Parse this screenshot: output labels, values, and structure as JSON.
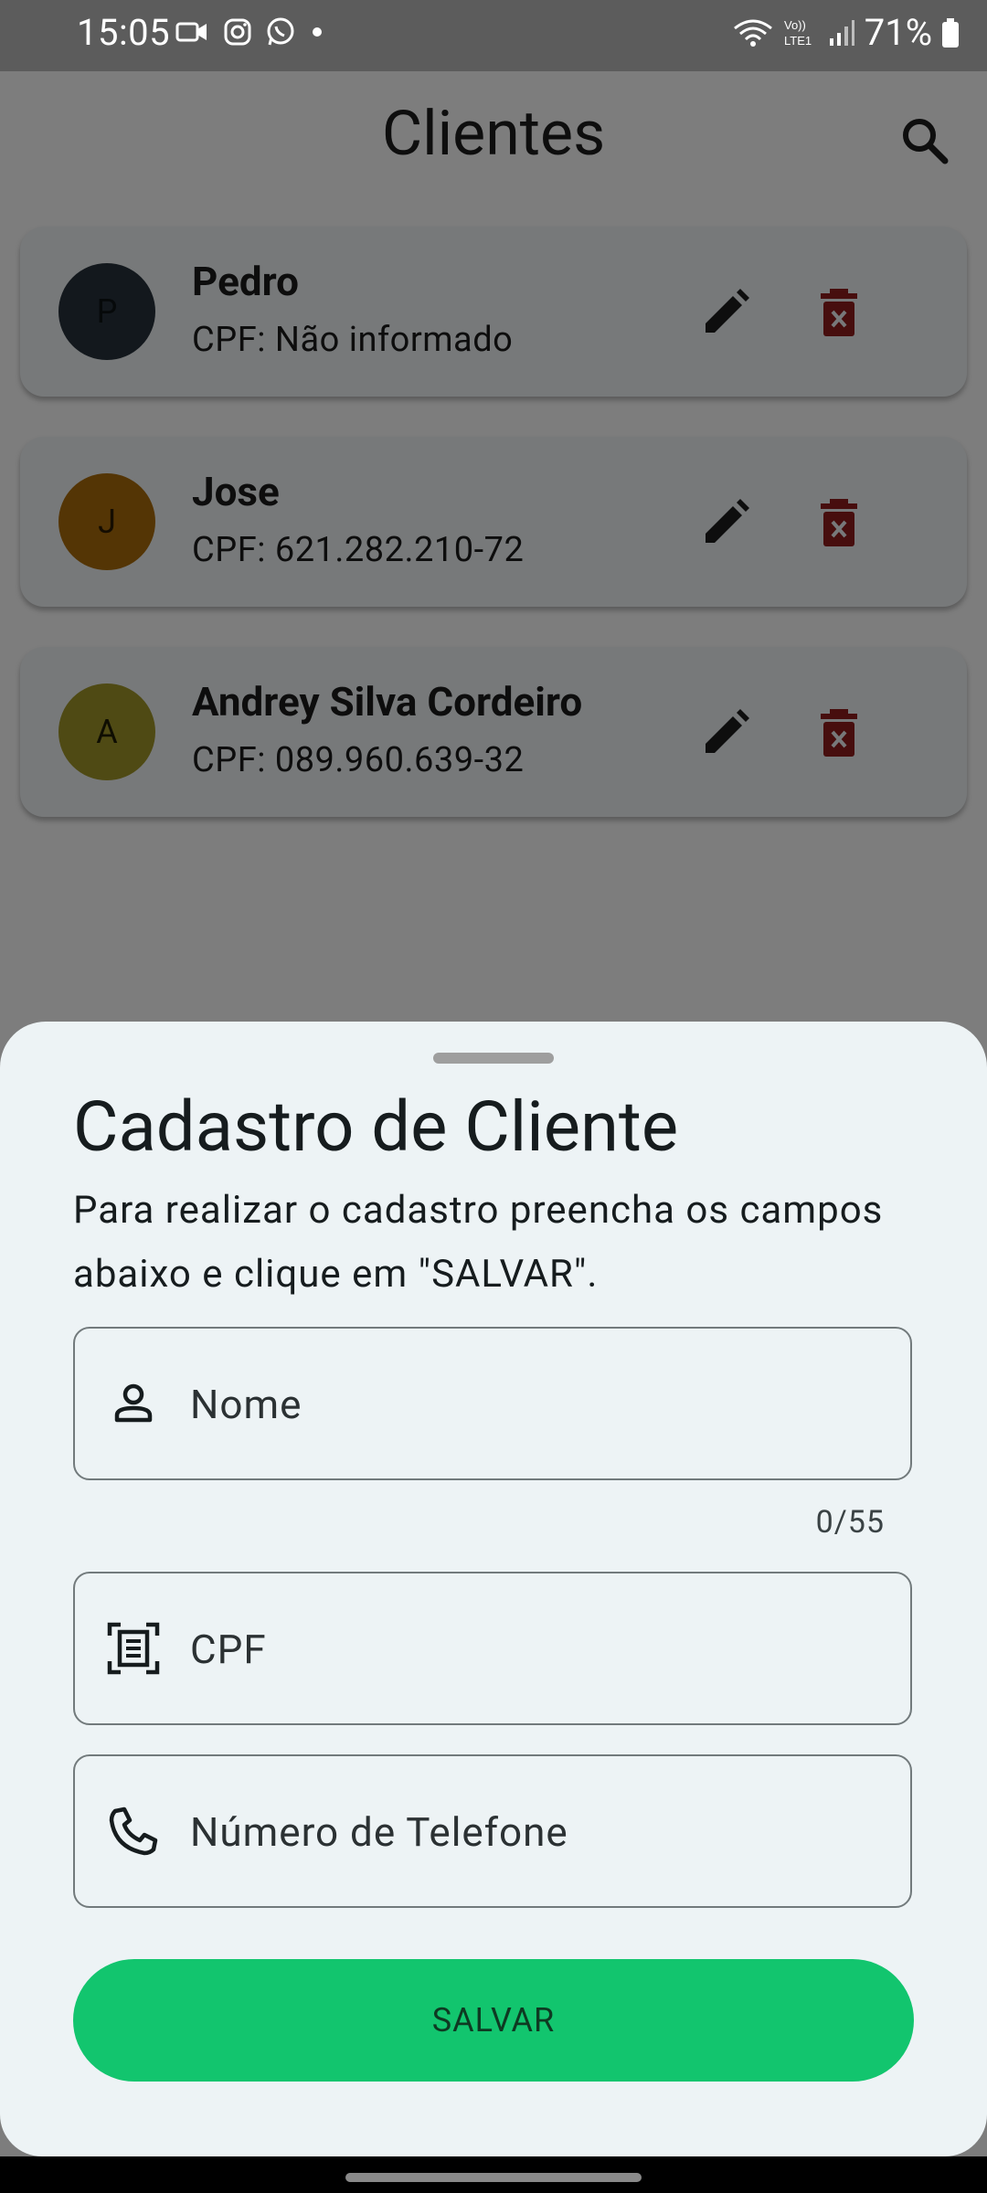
{
  "status_bar": {
    "time": "15:05",
    "left_icons": [
      "video-icon",
      "instagram-icon",
      "whatsapp-icon",
      "dot-icon"
    ],
    "right_icons": [
      "wifi-icon",
      "volte-icon",
      "signal-icon",
      "battery-icon"
    ],
    "battery_percent": "71%"
  },
  "app_bar": {
    "title": "Clientes",
    "search_icon": "search-icon"
  },
  "clients": [
    {
      "initial": "P",
      "name": "Pedro",
      "cpf": "CPF: Não informado",
      "avatar_color": "#26313a"
    },
    {
      "initial": "J",
      "name": "Jose",
      "cpf": "CPF: 621.282.210-72",
      "avatar_color": "#a86a0a"
    },
    {
      "initial": "A",
      "name": "Andrey Silva Cordeiro",
      "cpf": "CPF: 089.960.639-32",
      "avatar_color": "#9e9429"
    }
  ],
  "sheet": {
    "title": "Cadastro de Cliente",
    "description": "Para realizar o cadastro preencha os campos abaixo e clique em \"SALVAR\".",
    "fields": {
      "name_placeholder": "Nome",
      "name_counter": "0/55",
      "cpf_placeholder": "CPF",
      "phone_placeholder": "Número de Telefone"
    },
    "save_label": "SALVAR"
  },
  "colors": {
    "accent_green": "#12c56e",
    "delete_red": "#8e1d1d",
    "sheet_bg": "#edf3f5"
  }
}
